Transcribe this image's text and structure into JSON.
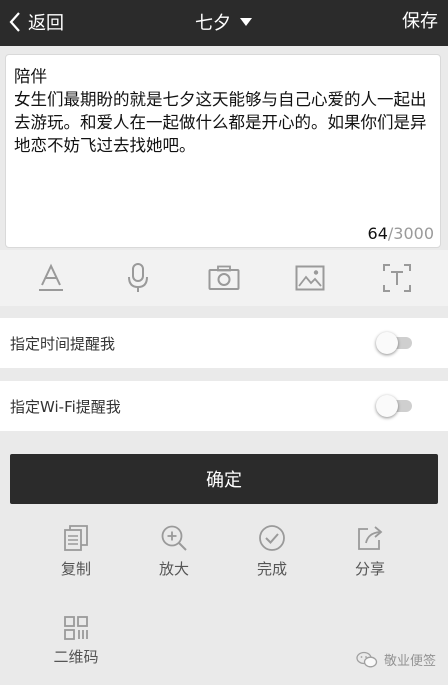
{
  "topbar": {
    "back_label": "返回",
    "title": "七夕",
    "save_label": "保存"
  },
  "note": {
    "text": "陪伴\n女生们最期盼的就是七夕这天能够与自己心爱的人一起出去游玩。和爱人在一起做什么都是开心的。如果你们是异地恋不妨飞过去找她吧。",
    "char_count": "64",
    "separator": "/",
    "char_limit": "3000"
  },
  "toolbar": {
    "icons": [
      "font-style-icon",
      "microphone-icon",
      "camera-icon",
      "image-icon",
      "text-recognition-icon"
    ]
  },
  "settings": {
    "time_reminder_label": "指定时间提醒我",
    "time_reminder_on": false,
    "wifi_reminder_label": "指定Wi-Fi提醒我",
    "wifi_reminder_on": false
  },
  "confirm_label": "确定",
  "actions": {
    "copy_label": "复制",
    "zoom_label": "放大",
    "complete_label": "完成",
    "share_label": "分享",
    "qrcode_label": "二维码"
  },
  "watermark_text": "敬业便签",
  "colors": {
    "topbar_bg": "#2b2b2b",
    "page_bg": "#eaeaea",
    "icon_gray": "#9a9a9a"
  }
}
